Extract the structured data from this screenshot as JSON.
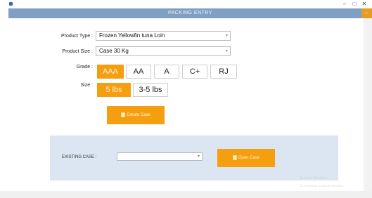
{
  "window": {
    "title": "PACKING ENTRY",
    "controls": {
      "minimize": "–",
      "maximize": "□",
      "close": "✕"
    },
    "accent_label": "—"
  },
  "form": {
    "product_type": {
      "label": "Product Type :",
      "value": "Frozen Yellowfin tuna Loin"
    },
    "product_size": {
      "label": "Product Size :",
      "value": "Case 30 Kg"
    },
    "grade": {
      "label": "Grade :",
      "options": [
        "AAA",
        "AA",
        "A",
        "C+",
        "RJ"
      ],
      "selected": "AAA"
    },
    "size": {
      "label": "Size :",
      "options": [
        "5 lbs",
        "3-5 lbs"
      ],
      "selected": "5 lbs"
    },
    "create_case_label": "Create Case"
  },
  "existing": {
    "label": "EXISTING CASE :",
    "value": "",
    "open_case_label": "Open Case"
  },
  "watermark": {
    "line1": "Activate Windows",
    "line2": "Go to Settings to activate Windows."
  },
  "colors": {
    "header": "#7f9fc4",
    "accent": "#f59f10",
    "panel": "#dbe6f2"
  }
}
